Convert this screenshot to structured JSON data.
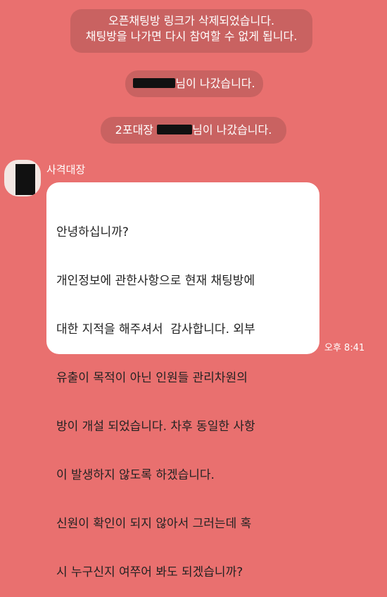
{
  "system_messages": {
    "notice_line1": "오픈채팅방 링크가 삭제되었습니다.",
    "notice_line2": "채팅방을 나가면 다시 참여할 수 없게 됩니다.",
    "left1_suffix": "님이 나갔습니다.",
    "left2_prefix": "2포대장",
    "left2_suffix": "님이 나갔습니다."
  },
  "message": {
    "sender": "사격대장",
    "lines": [
      "안녕하십니까?",
      "개인정보에 관한사항으로 현재 채팅방에",
      "대한 지적을 해주셔서  감사합니다. 외부",
      "유출이 목적이 아닌 인원들 관리차원의",
      "방이 개설 되었습니다. 차후 동일한 사항",
      "이 발생하지 않도록 하겠습니다.",
      "신원이 확인이 되지 않아서 그러는데 혹",
      "시 누구신지 여쭈어 봐도 되겠습니까?"
    ],
    "time": "오후 8:41"
  },
  "colors": {
    "background": "#e9706f",
    "bubble": "#ffffff",
    "system_pill": "rgba(150,75,75,0.38)"
  }
}
